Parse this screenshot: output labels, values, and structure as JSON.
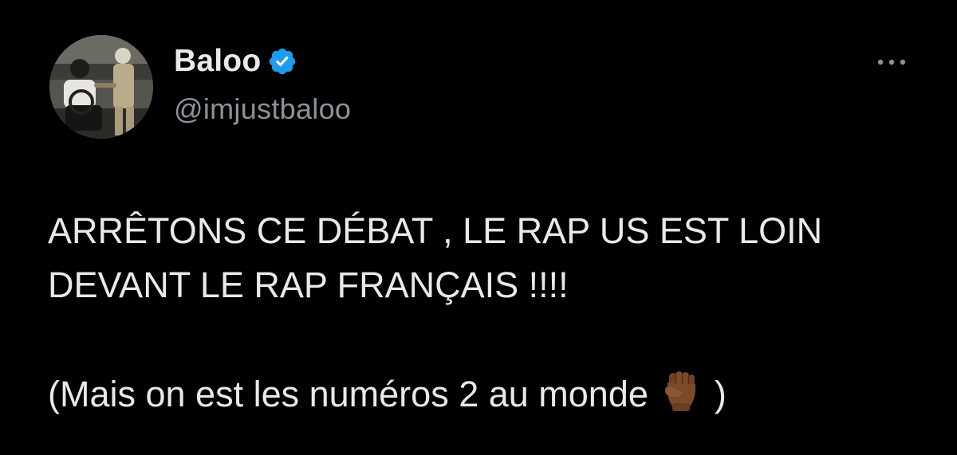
{
  "tweet": {
    "author": {
      "display_name": "Baloo",
      "handle": "@imjustbaloo",
      "verified": true,
      "avatar_icon": "profile-photo"
    },
    "more_icon": "ellipsis-icon",
    "text": {
      "line1": "ARRÊTONS CE DÉBAT , LE RAP US EST LOIN",
      "line2": "DEVANT LE RAP FRANÇAIS !!!!",
      "line3_before_emoji": "(Mais on est les numéros 2 au monde ",
      "line3_after_emoji": " )",
      "emoji": "raised-fist-medium-dark-skin"
    }
  },
  "colors": {
    "background": "#000000",
    "text_primary": "#e7e9ea",
    "text_secondary": "#8b9299",
    "verified_blue": "#1d9bf0",
    "emoji_skin": "#7a4a2a"
  }
}
